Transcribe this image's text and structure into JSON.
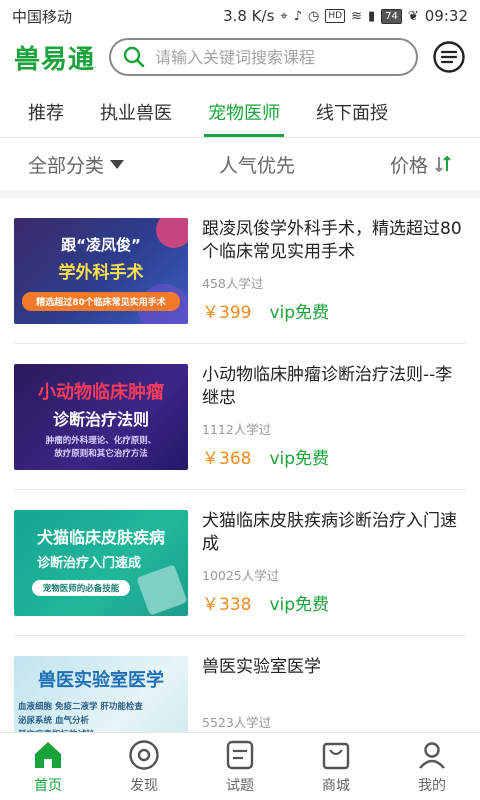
{
  "status_bar": {
    "carrier": "中国移动",
    "speed": "3.8 K/s",
    "hd": "HD",
    "battery": "74",
    "time": "09:32"
  },
  "header": {
    "brand": "兽易通",
    "search_placeholder": "请输入关键词搜索课程"
  },
  "tabs": [
    {
      "label": "推荐",
      "active": false
    },
    {
      "label": "执业兽医",
      "active": false
    },
    {
      "label": "宠物医师",
      "active": true
    },
    {
      "label": "线下面授",
      "active": false
    }
  ],
  "filters": {
    "category": "全部分类",
    "popularity": "人气优先",
    "price": "价格"
  },
  "courses": [
    {
      "title": "跟凌凤俊学外科手术，精选超过80个临床常见实用手术",
      "learners": "458人学过",
      "price": "￥399",
      "vip": "vip免费",
      "thumb_lines": [
        "跟“凌凤俊”",
        "学外科手术",
        "精选超过80个临床常见实用手术"
      ]
    },
    {
      "title": "小动物临床肿瘤诊断治疗法则--李继忠",
      "learners": "1112人学过",
      "price": "￥368",
      "vip": "vip免费",
      "thumb_lines": [
        "小动物临床肿瘤",
        "诊断治疗法则",
        "肿瘤的外科理论、化疗原则、",
        "放疗原则和其它治疗方法"
      ]
    },
    {
      "title": "犬猫临床皮肤疾病诊断治疗入门速成",
      "learners": "10025人学过",
      "price": "￥338",
      "vip": "vip免费",
      "thumb_lines": [
        "犬猫临床皮肤疾病",
        "诊断治疗入门速成",
        "宠物医师的必备技能"
      ]
    },
    {
      "title": "兽医实验室医学",
      "learners": "5523人学过",
      "price": "",
      "vip": "",
      "thumb_lines": [
        "兽医实验室医学",
        "血液细胞 免疫二液学 肝功能检查",
        "泌尿系统 血气分析",
        "其它病毒指标的试验"
      ]
    }
  ],
  "bottom_nav": [
    {
      "label": "首页",
      "icon": "home-icon",
      "active": true
    },
    {
      "label": "发现",
      "icon": "discover-icon",
      "active": false
    },
    {
      "label": "试题",
      "icon": "exam-icon",
      "active": false
    },
    {
      "label": "商城",
      "icon": "shop-icon",
      "active": false
    },
    {
      "label": "我的",
      "icon": "profile-icon",
      "active": false
    }
  ],
  "colors": {
    "brand_green": "#1aa33a",
    "price_orange": "#f08a1a"
  }
}
